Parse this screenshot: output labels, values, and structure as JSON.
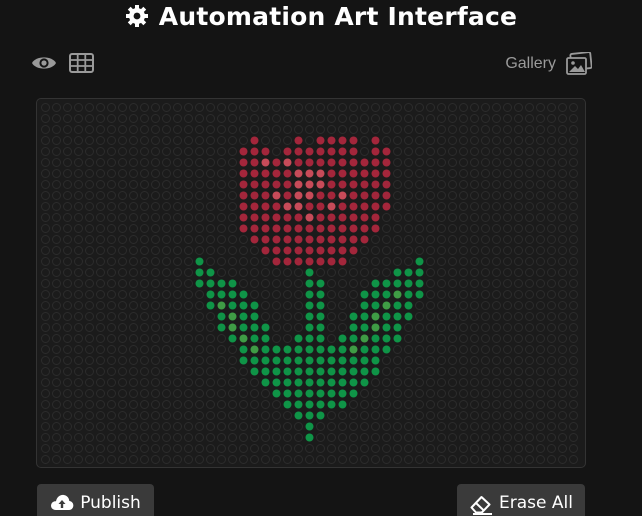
{
  "header": {
    "title": "Automation Art Interface",
    "icon": "gear-icon"
  },
  "toolbar": {
    "preview_icon": "eye-icon",
    "grid_icon": "grid-icon",
    "gallery_label": "Gallery",
    "gallery_icon": "images-icon"
  },
  "canvas": {
    "dot_grid": {
      "columns": 49,
      "rows": 33
    },
    "colors": {
      "background": "#1b1b1b",
      "empty_dot_outline": "#2c2c2c",
      "petal": "#a3263b",
      "petal_light": "#c74b59",
      "stem": "#0f9447",
      "stem_light": "#3f9c45"
    },
    "artwork": "tulip"
  },
  "actions": {
    "publish_label": "Publish",
    "publish_icon": "cloud-upload-icon",
    "erase_label": "Erase All",
    "erase_icon": "eraser-icon"
  }
}
